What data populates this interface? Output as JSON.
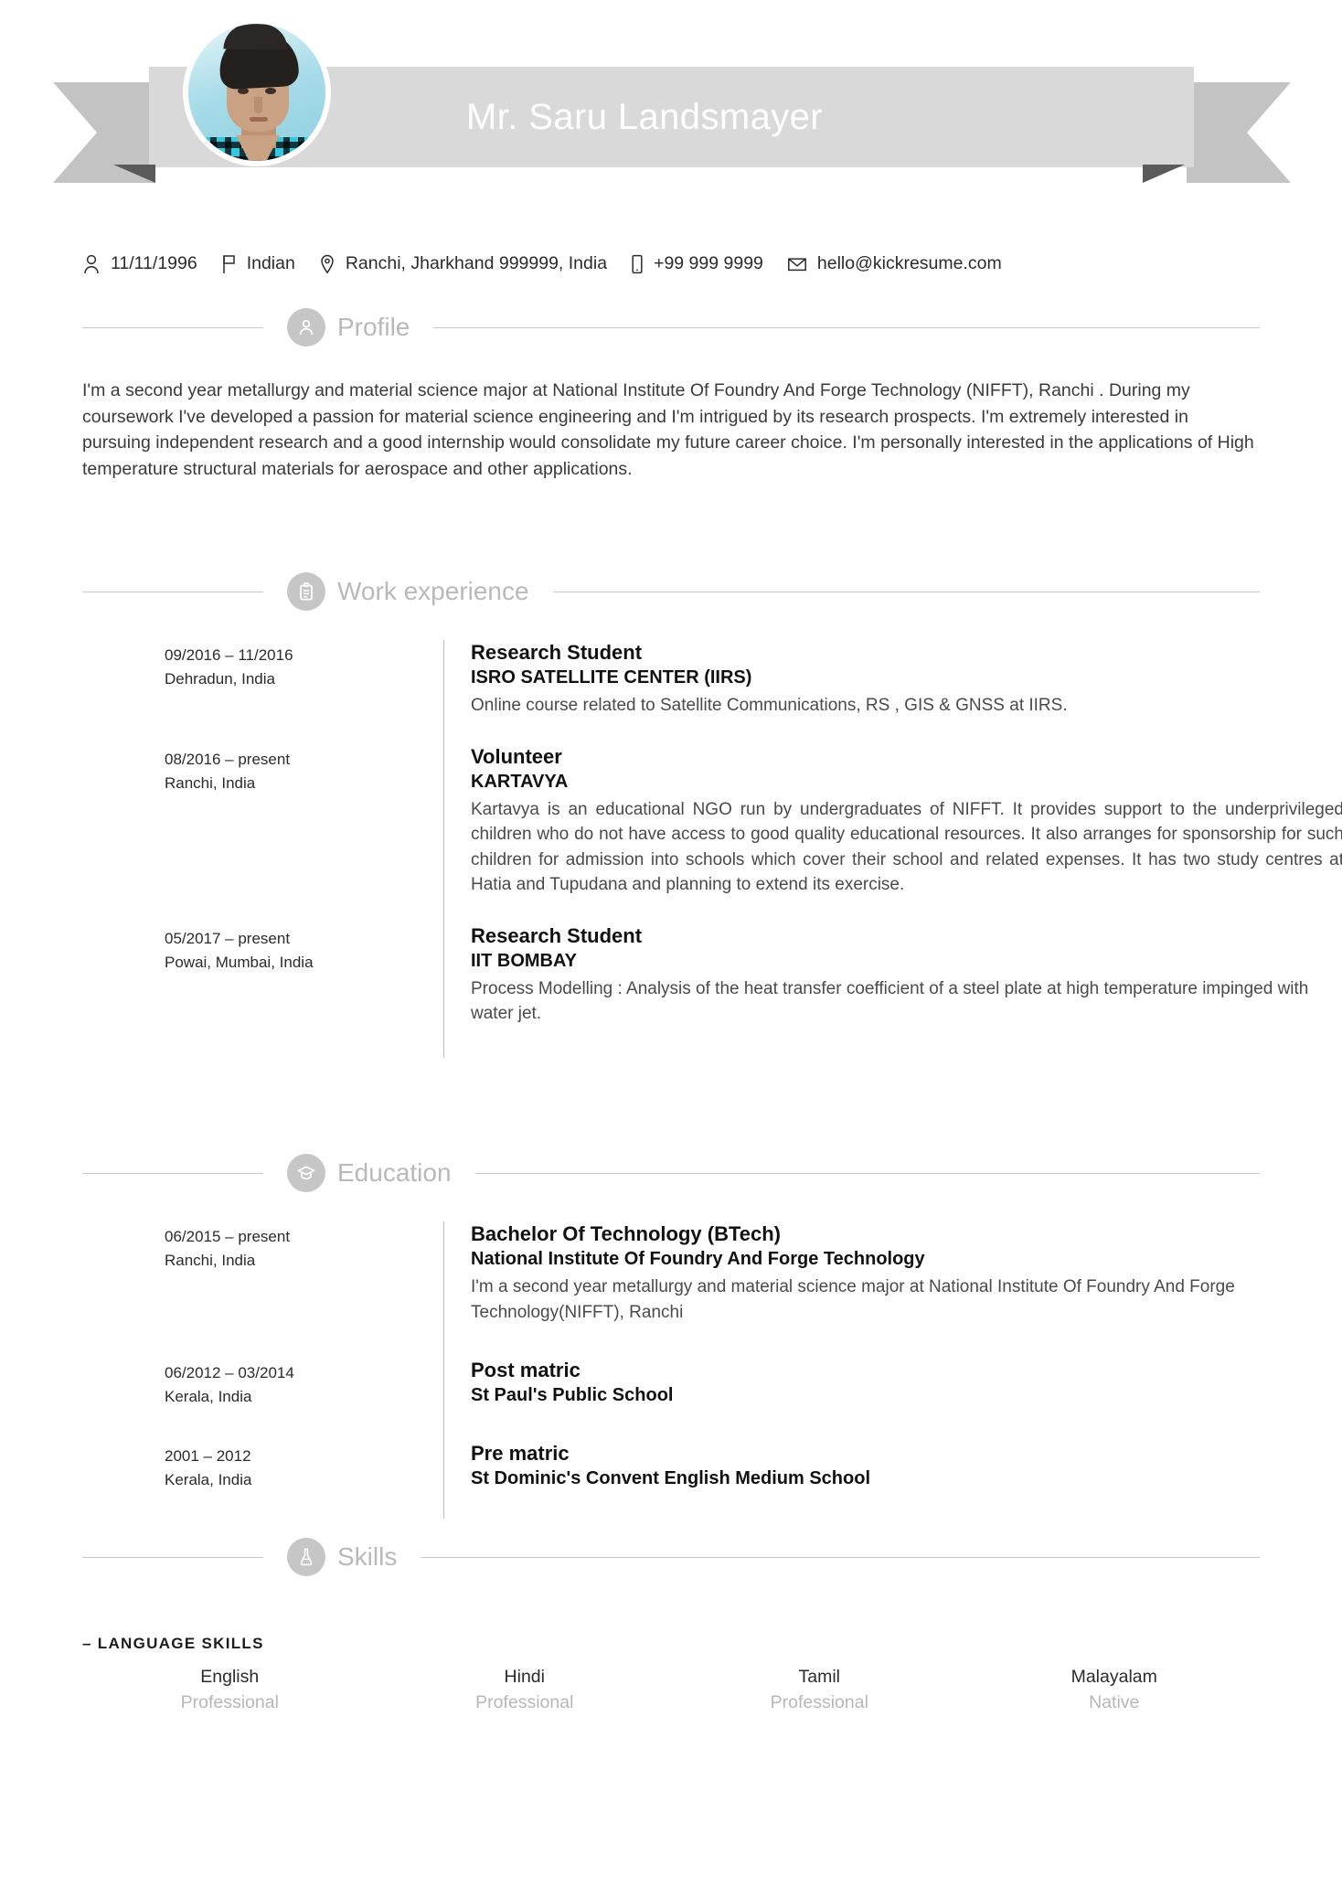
{
  "header": {
    "full_name": "Mr. Saru Landsmayer",
    "avatar_alt": "profile-photo"
  },
  "contact": [
    {
      "icon": "person-icon",
      "value": "11/11/1996"
    },
    {
      "icon": "flag-icon",
      "value": "Indian"
    },
    {
      "icon": "location-pin-icon",
      "value": "Ranchi, Jharkhand 999999, India"
    },
    {
      "icon": "phone-icon",
      "value": "+99 999 9999"
    },
    {
      "icon": "envelope-icon",
      "value": "hello@kickresume.com"
    }
  ],
  "sections": {
    "profile": {
      "title": "Profile",
      "icon": "person-badge-icon",
      "text": "I'm a second year metallurgy and material science major at National Institute Of Foundry And Forge Technology (NIFFT), Ranchi . During my coursework I've developed a passion for material science engineering and I'm intrigued by its research prospects. I'm extremely interested in pursuing independent research and a good internship would consolidate my future career choice. I'm personally interested in the applications of  High temperature structural materials for aerospace and other applications."
    },
    "work": {
      "title": "Work experience",
      "icon": "briefcase-icon",
      "items": [
        {
          "date": "09/2016 – 11/2016",
          "location": "Dehradun, India",
          "title": "Research Student",
          "organization": "ISRO SATELLITE CENTER (IIRS)",
          "description": "Online course related to Satellite Communications, RS , GIS & GNSS at IIRS."
        },
        {
          "date": "08/2016 – present",
          "location": "Ranchi, India",
          "title": "Volunteer",
          "organization": "KARTAVYA",
          "description": "Kartavya is an educational NGO run by undergraduates of NIFFT. It provides support to the underprivileged children who do not have access to good quality educational resources. It also arranges for sponsorship for such children for admission into schools which cover their school and related expenses. It has two study centres at Hatia and Tupudana and planning to extend its exercise."
        },
        {
          "date": "05/2017 – present",
          "location": "Powai, Mumbai, India",
          "title": "Research Student",
          "organization": "IIT BOMBAY",
          "description": "Process Modelling : Analysis of the heat transfer coefficient of a steel plate at high temperature impinged with water jet."
        }
      ]
    },
    "education": {
      "title": "Education",
      "icon": "graduation-cap-icon",
      "items": [
        {
          "date": "06/2015 – present",
          "location": "Ranchi, India",
          "title": "Bachelor Of Technology (BTech)",
          "organization": "National Institute Of Foundry And Forge Technology",
          "description": "I'm a second year metallurgy and material science major at National Institute Of Foundry And Forge Technology(NIFFT), Ranchi"
        },
        {
          "date": "06/2012 – 03/2014",
          "location": "Kerala, India",
          "title": "Post matric",
          "organization": "St Paul's Public School",
          "description": ""
        },
        {
          "date": "2001 – 2012",
          "location": "Kerala, India",
          "title": "Pre matric",
          "organization": "St Dominic's Convent English Medium School",
          "description": ""
        }
      ]
    },
    "skills": {
      "title": "Skills",
      "icon": "flask-icon",
      "language_skills_heading": "– LANGUAGE SKILLS",
      "languages": [
        {
          "name": "English",
          "level": "Professional"
        },
        {
          "name": "Hindi",
          "level": "Professional"
        },
        {
          "name": "Tamil",
          "level": "Professional"
        },
        {
          "name": "Malayalam",
          "level": "Native"
        }
      ]
    }
  },
  "colors": {
    "ribbon_band": "#d9d9d9",
    "ribbon_tail": "#c3c3c3",
    "ribbon_fold": "#5a5a5a",
    "section_badge": "#c6c6c6",
    "section_title": "#b9b9b9",
    "rule": "#c9c9c9",
    "timeline": "#bdbdbd",
    "muted_text": "#b7b7b7"
  }
}
